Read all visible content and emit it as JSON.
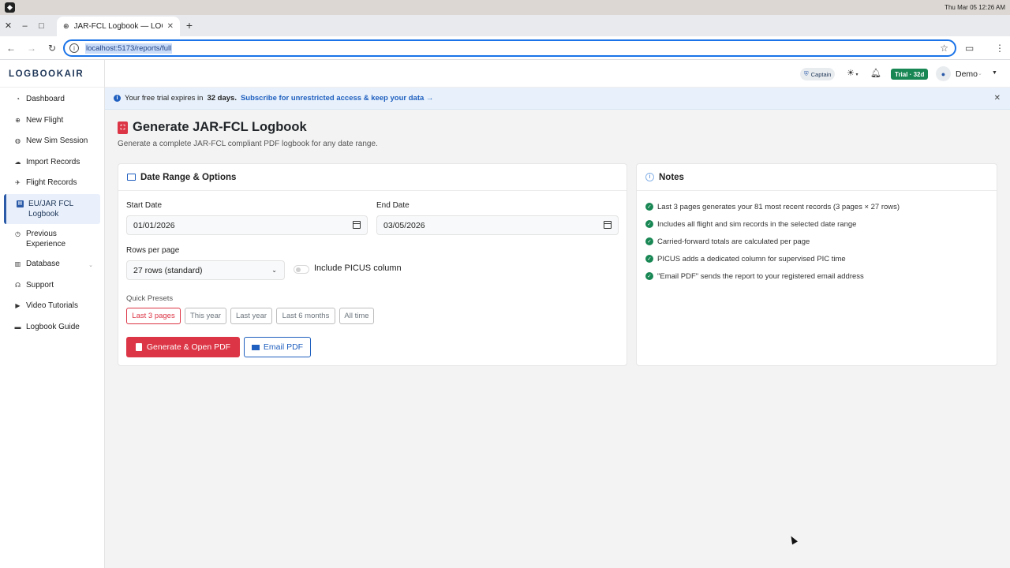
{
  "os": {
    "clock": "Thu Mar 05  12:26 AM"
  },
  "browser": {
    "tab_title": "JAR-FCL Logbook — LOG",
    "url": "localhost:5173/reports/full"
  },
  "brand": "LOGBOOKAIR",
  "sidebar": {
    "items": [
      {
        "label": "Dashboard",
        "icon": "dashboard-icon"
      },
      {
        "label": "New Flight",
        "icon": "plus-circle-icon"
      },
      {
        "label": "New Sim Session",
        "icon": "sim-icon"
      },
      {
        "label": "Import Records",
        "icon": "cloud-upload-icon"
      },
      {
        "label": "Flight Records",
        "icon": "plane-icon"
      },
      {
        "label": "EU/JAR FCL Logbook",
        "icon": "pdf-icon",
        "active": true
      },
      {
        "label": "Previous Experience",
        "icon": "history-icon"
      },
      {
        "label": "Database",
        "icon": "database-icon",
        "has_submenu": true
      },
      {
        "label": "Support",
        "icon": "headset-icon"
      },
      {
        "label": "Video Tutorials",
        "icon": "play-icon"
      },
      {
        "label": "Logbook Guide",
        "icon": "book-icon"
      }
    ]
  },
  "header": {
    "role_badge": "Captain",
    "trial_badge": "Trial · 32d",
    "user_name": "Demo"
  },
  "banner": {
    "text_before": "Your free trial expires in",
    "days": "32 days.",
    "link": "Subscribe for unrestricted access & keep your data →"
  },
  "page": {
    "title": "Generate JAR-FCL Logbook",
    "subtitle": "Generate a complete JAR-FCL compliant PDF logbook for any date range."
  },
  "options_card": {
    "title": "Date Range & Options",
    "start_label": "Start Date",
    "start_value": "01/01/2026",
    "end_label": "End Date",
    "end_value": "03/05/2026",
    "rows_label": "Rows per page",
    "rows_value": "27 rows (standard)",
    "picus_label": "Include PICUS column",
    "picus_enabled": false,
    "presets_label": "Quick Presets",
    "presets": [
      "Last 3 pages",
      "This year",
      "Last year",
      "Last 6 months",
      "All time"
    ],
    "active_preset": "Last 3 pages",
    "generate_label": "Generate & Open PDF",
    "email_label": "Email PDF"
  },
  "notes_card": {
    "title": "Notes",
    "items": [
      "Last 3 pages generates your 81 most recent records (3 pages × 27 rows)",
      "Includes all flight and sim records in the selected date range",
      "Carried-forward totals are calculated per page",
      "PICUS adds a dedicated column for supervised PIC time",
      "\"Email PDF\" sends the report to your registered email address"
    ]
  },
  "colors": {
    "accent_blue": "#1f5fbf",
    "danger_red": "#dc3545",
    "success_green": "#198754",
    "brand_navy": "#1d3557"
  }
}
